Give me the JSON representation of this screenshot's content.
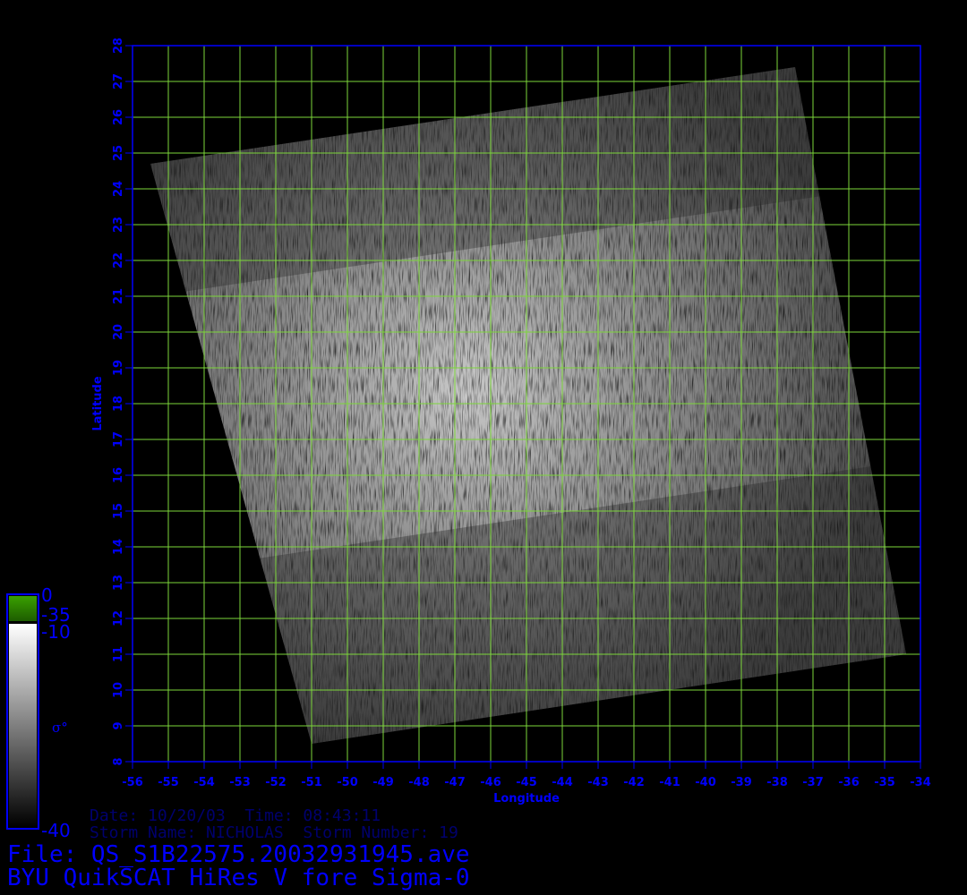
{
  "chart_data": {
    "type": "heatmap",
    "xlabel": "Longitude",
    "ylabel": "Latitude",
    "xlim": [
      -56,
      -34
    ],
    "ylim": [
      8,
      28
    ],
    "x_ticks": [
      "-56",
      "-55",
      "-54",
      "-53",
      "-52",
      "-51",
      "-50",
      "-49",
      "-48",
      "-47",
      "-46",
      "-45",
      "-44",
      "-43",
      "-42",
      "-41",
      "-40",
      "-39",
      "-38",
      "-37",
      "-36",
      "-35",
      "-34"
    ],
    "y_ticks": [
      "8",
      "9",
      "10",
      "11",
      "12",
      "13",
      "14",
      "15",
      "16",
      "17",
      "18",
      "19",
      "20",
      "21",
      "22",
      "23",
      "24",
      "25",
      "26",
      "27",
      "28"
    ],
    "grid": true,
    "grid_color": "#7cd63a",
    "swath_corners_lonlat": [
      [
        -55.5,
        24.7
      ],
      [
        -37.5,
        27.4
      ],
      [
        -34.4,
        11.0
      ],
      [
        -51.0,
        8.5
      ]
    ],
    "colorbar": {
      "labels": [
        "0",
        "-35",
        "-10",
        "-40"
      ],
      "symbol": "σ°",
      "land_color": "#2e8b00"
    }
  },
  "info": {
    "date_line": "Date: 10/20/03  Time: 08:43:11",
    "storm_line": "Storm Name: NICHOLAS  Storm Number: 19",
    "file_line": "File: QS_S1B22575.20032931945.ave",
    "product_line": "BYU QuikSCAT HiRes V fore Sigma-0"
  },
  "colors": {
    "axis": "#0000ff",
    "text_dim": "#00006e",
    "grid": "#7cd63a"
  }
}
